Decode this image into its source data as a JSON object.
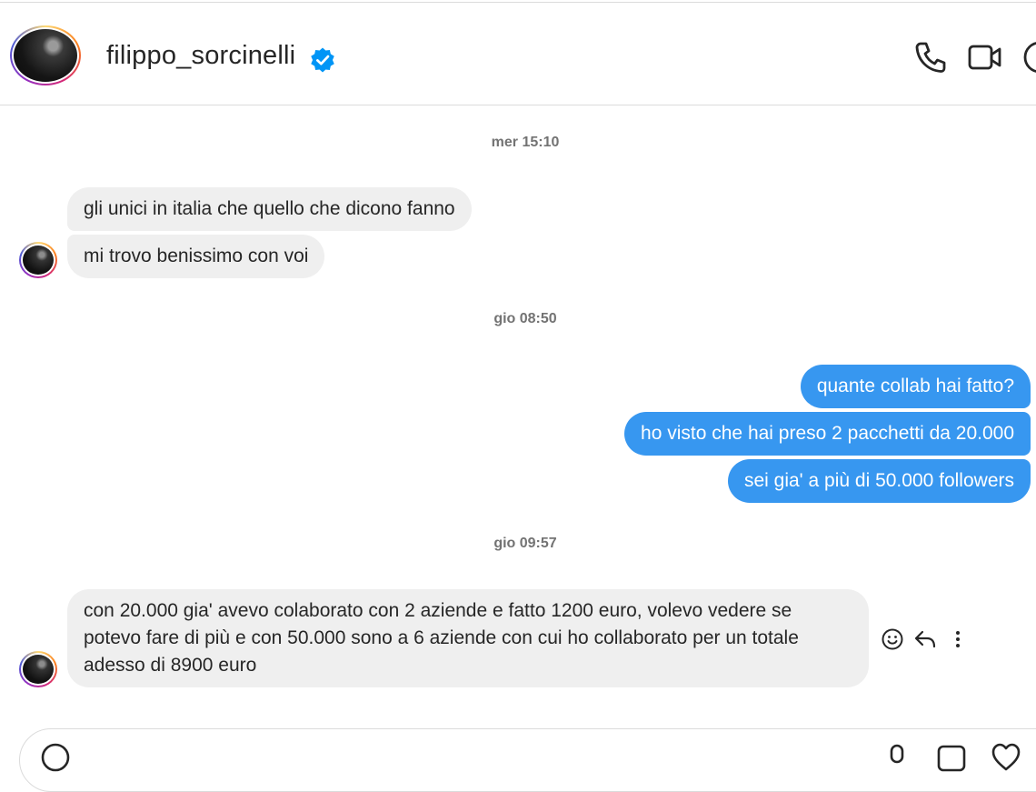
{
  "header": {
    "username": "filippo_sorcinelli",
    "verified": true,
    "icons": [
      "phone-icon",
      "video-camera-icon",
      "info-icon"
    ]
  },
  "conversation": {
    "timestamps": [
      "mer 15:10",
      "gio 08:50",
      "gio 09:57"
    ],
    "messages": [
      {
        "sender": "them",
        "text": "gli unici in italia che quello che dicono fanno"
      },
      {
        "sender": "them",
        "text": "mi trovo benissimo con voi"
      },
      {
        "sender": "me",
        "text": "quante collab hai fatto?"
      },
      {
        "sender": "me",
        "text": "ho visto che hai preso 2 pacchetti da 20.000"
      },
      {
        "sender": "me",
        "text": "sei gia' a più di 50.000 followers"
      },
      {
        "sender": "them",
        "lines": [
          "con 20.000 gia' avevo colaborato con 2 aziende e fatto 1200 euro, volevo vedere se",
          "potevo fare di più e con 50.000 sono a 6 aziende con cui ho collaborato per un totale",
          "adesso di 8900 euro"
        ]
      }
    ],
    "message_actions": [
      "emoji-react-icon",
      "reply-icon",
      "more-options-icon"
    ]
  },
  "composer": {
    "placeholder": "",
    "icons": [
      "emoji-icon",
      "microphone-icon",
      "image-icon",
      "heart-icon"
    ]
  },
  "colors": {
    "outgoing_bubble": "#3797f0",
    "incoming_bubble": "#efefef",
    "verified_badge": "#0095f6",
    "divider": "#dbdbdb"
  }
}
